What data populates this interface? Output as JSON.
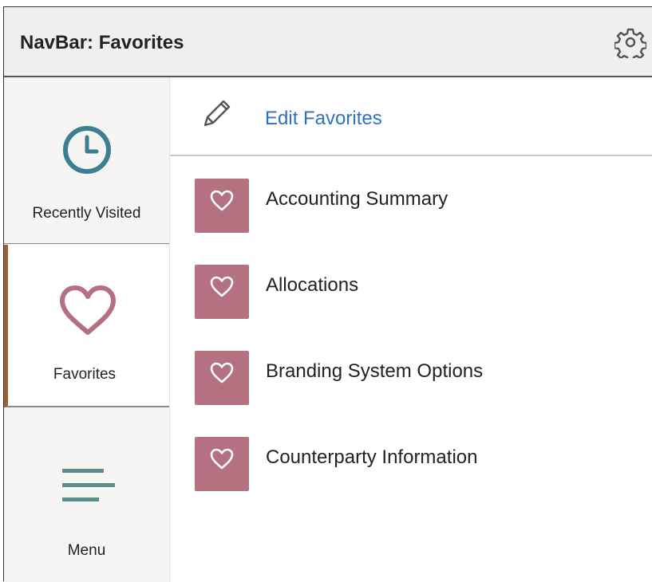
{
  "header": {
    "title": "NavBar: Favorites",
    "settings_icon": "gear-icon"
  },
  "sidebar": {
    "items": [
      {
        "label": "Recently Visited",
        "icon": "clock-icon",
        "selected": false
      },
      {
        "label": "Favorites",
        "icon": "heart-icon",
        "selected": true
      },
      {
        "label": "Menu",
        "icon": "menu-lines-icon",
        "selected": false
      }
    ]
  },
  "main": {
    "edit": {
      "label": "Edit Favorites",
      "icon": "pencil-icon"
    },
    "favorites": [
      {
        "label": "Accounting Summary",
        "icon": "heart-icon"
      },
      {
        "label": "Allocations",
        "icon": "heart-icon"
      },
      {
        "label": "Branding System Options",
        "icon": "heart-icon"
      },
      {
        "label": "Counterparty Information",
        "icon": "heart-icon"
      }
    ]
  },
  "colors": {
    "header_bg": "#f0efee",
    "sidebar_bg": "#f6f5f4",
    "link_blue": "#2f72bf",
    "clock_teal": "#3b7f93",
    "heart_rose": "#b46f80",
    "tile_rose": "#b47180",
    "menu_teal": "#5c8e8c",
    "selected_bar": "#a06035"
  }
}
